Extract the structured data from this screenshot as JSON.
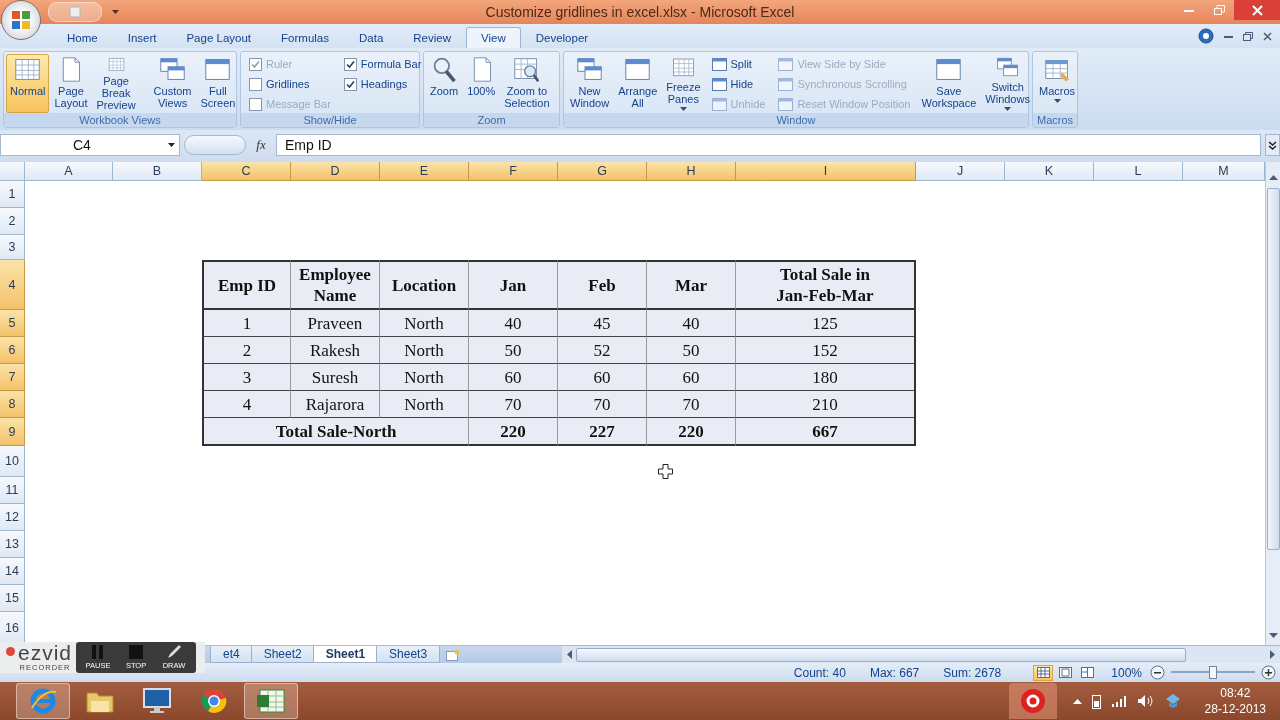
{
  "window": {
    "title": "Customize gridlines in excel.xlsx - Microsoft Excel"
  },
  "ribbon": {
    "tabs": [
      {
        "label": "Home",
        "selected": false
      },
      {
        "label": "Insert",
        "selected": false
      },
      {
        "label": "Page Layout",
        "selected": false
      },
      {
        "label": "Formulas",
        "selected": false
      },
      {
        "label": "Data",
        "selected": false
      },
      {
        "label": "Review",
        "selected": false
      },
      {
        "label": "View",
        "selected": true
      },
      {
        "label": "Developer",
        "selected": false
      }
    ],
    "groups": [
      {
        "label": "Workbook Views",
        "items": [
          {
            "kind": "large",
            "label": "Normal",
            "selected": true
          },
          {
            "kind": "large",
            "label": "Page\nLayout",
            "selected": false
          },
          {
            "kind": "large",
            "label": "Page Break\nPreview",
            "selected": false
          },
          {
            "kind": "large",
            "label": "Custom\nViews",
            "selected": false
          },
          {
            "kind": "large",
            "label": "Full\nScreen",
            "selected": false
          }
        ]
      },
      {
        "label": "Show/Hide",
        "items": [
          {
            "kind": "check",
            "label": "Ruler",
            "checked": true,
            "disabled": true
          },
          {
            "kind": "check",
            "label": "Gridlines",
            "checked": false,
            "disabled": false
          },
          {
            "kind": "check",
            "label": "Message Bar",
            "checked": false,
            "disabled": true
          },
          {
            "kind": "check",
            "label": "Formula Bar",
            "checked": true,
            "disabled": false
          },
          {
            "kind": "check",
            "label": "Headings",
            "checked": true,
            "disabled": false
          }
        ]
      },
      {
        "label": "Zoom",
        "items": [
          {
            "kind": "large",
            "label": "Zoom"
          },
          {
            "kind": "large",
            "label": "100%"
          },
          {
            "kind": "large",
            "label": "Zoom to\nSelection"
          }
        ]
      },
      {
        "label": "Window",
        "items": [
          {
            "kind": "large",
            "label": "New\nWindow"
          },
          {
            "kind": "large",
            "label": "Arrange\nAll"
          },
          {
            "kind": "large",
            "label": "Freeze\nPanes",
            "dropdown": true
          },
          {
            "kind": "small",
            "label": "Split",
            "disabled": false
          },
          {
            "kind": "small",
            "label": "Hide",
            "disabled": false
          },
          {
            "kind": "small",
            "label": "Unhide",
            "disabled": true
          },
          {
            "kind": "small",
            "label": "View Side by Side",
            "disabled": true
          },
          {
            "kind": "small",
            "label": "Synchronous Scrolling",
            "disabled": true
          },
          {
            "kind": "small",
            "label": "Reset Window Position",
            "disabled": true
          },
          {
            "kind": "large",
            "label": "Save\nWorkspace"
          },
          {
            "kind": "large",
            "label": "Switch\nWindows",
            "dropdown": true
          }
        ]
      },
      {
        "label": "Macros",
        "items": [
          {
            "kind": "large",
            "label": "Macros",
            "dropdown": true
          }
        ]
      }
    ]
  },
  "formula_bar": {
    "name_box": "C4",
    "function_label": "fx",
    "formula": "Emp ID"
  },
  "sheet": {
    "columns": [
      {
        "label": "A",
        "selected": false
      },
      {
        "label": "B",
        "selected": false
      },
      {
        "label": "C",
        "selected": true
      },
      {
        "label": "D",
        "selected": true
      },
      {
        "label": "E",
        "selected": true
      },
      {
        "label": "F",
        "selected": true
      },
      {
        "label": "G",
        "selected": true
      },
      {
        "label": "H",
        "selected": true
      },
      {
        "label": "I",
        "selected": true
      },
      {
        "label": "J",
        "selected": false
      },
      {
        "label": "K",
        "selected": false
      },
      {
        "label": "L",
        "selected": false
      },
      {
        "label": "M",
        "selected": false
      }
    ],
    "rows": [
      {
        "label": "1",
        "selected": false
      },
      {
        "label": "2",
        "selected": false
      },
      {
        "label": "3",
        "selected": false
      },
      {
        "label": "4",
        "selected": true
      },
      {
        "label": "5",
        "selected": true
      },
      {
        "label": "6",
        "selected": true
      },
      {
        "label": "7",
        "selected": true
      },
      {
        "label": "8",
        "selected": true
      },
      {
        "label": "9",
        "selected": true
      },
      {
        "label": "10",
        "selected": false
      },
      {
        "label": "11",
        "selected": false
      },
      {
        "label": "12",
        "selected": false
      },
      {
        "label": "13",
        "selected": false
      },
      {
        "label": "14",
        "selected": false
      },
      {
        "label": "15",
        "selected": false
      },
      {
        "label": "16",
        "selected": false
      }
    ],
    "table": {
      "selected": true,
      "header": [
        "Emp ID",
        "Employee Name",
        "Location",
        "Jan",
        "Feb",
        "Mar",
        "Total Sale in\nJan-Feb-Mar"
      ],
      "rows": [
        [
          "1",
          "Praveen",
          "North",
          "40",
          "45",
          "40",
          "125"
        ],
        [
          "2",
          "Rakesh",
          "North",
          "50",
          "52",
          "50",
          "152"
        ],
        [
          "3",
          "Suresh",
          "North",
          "60",
          "60",
          "60",
          "180"
        ],
        [
          "4",
          "Rajarora",
          "North",
          "70",
          "70",
          "70",
          "210"
        ]
      ],
      "total": {
        "label": "Total Sale-North",
        "values": [
          "220",
          "227",
          "220",
          "667"
        ]
      }
    }
  },
  "sheet_tabs": [
    {
      "label": "et4",
      "selected": false
    },
    {
      "label": "Sheet2",
      "selected": false
    },
    {
      "label": "Sheet1",
      "selected": true
    },
    {
      "label": "Sheet3",
      "selected": false
    }
  ],
  "status_bar": {
    "stats": [
      "Count: 40",
      "Max: 667",
      "Sum: 2678"
    ],
    "views": [
      {
        "selected": true
      },
      {
        "selected": false
      },
      {
        "selected": false
      }
    ],
    "zoom": "100%",
    "zoom_slider": {
      "level": 0.5
    }
  },
  "recorder": {
    "logo": "ezvid",
    "subtitle": "RECORDER",
    "buttons": [
      "PAUSE",
      "STOP",
      "DRAW"
    ]
  },
  "taskbar": {
    "apps": [
      {
        "active": true
      },
      {
        "active": false
      },
      {
        "active": false
      },
      {
        "active": false
      },
      {
        "active": true
      }
    ],
    "time": "08:42",
    "date": "28-12-2013"
  }
}
